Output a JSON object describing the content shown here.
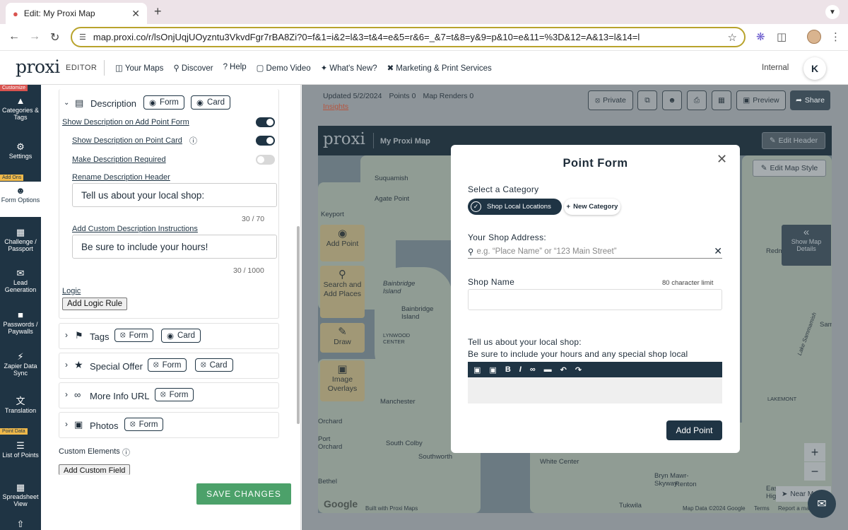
{
  "browser": {
    "tab_title": "Edit: My Proxi Map",
    "url": "map.proxi.co/r/lsOnjUqjUOyzntu3VkvdFgr7rBA8Zi?0=f&1=i&2=l&3=t&4=e&5=r&6=_&7=t&8=y&9=p&10=e&11=%3D&12=A&13=l&14=l"
  },
  "header": {
    "logo": "proxi",
    "editor_label": "EDITOR",
    "nav": [
      {
        "icon": "map-icon",
        "label": "Your Maps"
      },
      {
        "icon": "search-icon",
        "label": "Discover"
      },
      {
        "icon": "help-icon",
        "label": "Help"
      },
      {
        "icon": "video-icon",
        "label": "Demo Video"
      },
      {
        "icon": "sparkle-icon",
        "label": "What's New?"
      },
      {
        "icon": "tools-icon",
        "label": "Marketing & Print Services"
      }
    ],
    "internal_label": "Internal",
    "avatar_initial": "K"
  },
  "rail": {
    "tags": [
      "Customize",
      "Add Ons",
      "Point Data"
    ],
    "items": [
      {
        "label": "Categories & Tags"
      },
      {
        "label": "Settings"
      },
      {
        "label": "Form Options"
      },
      {
        "label": "Challenge / Passport"
      },
      {
        "label": "Lead Generation"
      },
      {
        "label": "Passwords / Paywalls"
      },
      {
        "label": "Zapier Data Sync"
      },
      {
        "label": "Translation"
      },
      {
        "label": "List of Points"
      },
      {
        "label": "Spreadsheet View"
      }
    ]
  },
  "panel": {
    "description": {
      "title": "Description",
      "form_label": "Form",
      "card_label": "Card",
      "show_on_form": "Show Description on Add Point Form",
      "show_on_card": "Show Description on Point Card",
      "make_required": "Make Description Required",
      "rename_header": "Rename Description Header",
      "header_value": "Tell us about your local shop:",
      "header_count": "30 / 70",
      "custom_instructions": "Add Custom Description Instructions",
      "instructions_value": "Be sure to include your hours!",
      "instructions_count": "30 / 1000",
      "logic_label": "Logic",
      "add_logic_rule": "Add Logic Rule"
    },
    "sections": [
      {
        "title": "Tags",
        "pills": [
          "Form",
          "Card"
        ]
      },
      {
        "title": "Special Offer",
        "pills": [
          "Form",
          "Card"
        ]
      },
      {
        "title": "More Info URL",
        "pills": [
          "Form"
        ]
      },
      {
        "title": "Photos",
        "pills": [
          "Form"
        ]
      }
    ],
    "custom_elements": "Custom Elements",
    "add_custom_field": "Add Custom Field",
    "save": "SAVE CHANGES"
  },
  "map": {
    "updated": "Updated 5/2/2024",
    "points": "Points 0",
    "renders": "Map Renders 0",
    "insights": "Insights",
    "toolbar": {
      "private": "Private",
      "preview": "Preview",
      "share": "Share"
    },
    "logo": "proxi",
    "map_name": "My Proxi Map",
    "edit_header": "Edit Header",
    "edit_style": "Edit Map Style",
    "tools": [
      "Add Point",
      "Search and Add Places",
      "Draw",
      "Image Overlays"
    ],
    "show_details": "Show Map Details",
    "near_me": "Near M",
    "labels": [
      "Suquamish",
      "Agate Point",
      "Keyport",
      "Bainbridge Island",
      "Bainbridge Island",
      "LYNWOOD CENTER",
      "Manchester",
      "Orchard",
      "Port Orchard",
      "South Colby",
      "Southworth",
      "White Center",
      "Bryn Mawr-Skyway",
      "Renton",
      "Tukwila",
      "East Highlan",
      "Redmond",
      "Sam",
      "LAKEMONT",
      "Lake Sammamish",
      "Bethel"
    ],
    "footer_built": "Built with Proxi Maps",
    "footer_data": "Map Data ©2024 Google",
    "footer_terms": "Terms",
    "footer_report": "Report a map",
    "google": "Google"
  },
  "modal": {
    "title": "Point Form",
    "select_category": "Select a Category",
    "selected_category": "Shop Local Locations",
    "new_category": "New Category",
    "address_label": "Your Shop Address:",
    "address_placeholder": "e.g. “Place Name” or “123 Main Street”",
    "name_label": "Shop Name",
    "char_limit": "80 character limit",
    "desc_label": "Tell us about your local shop:",
    "desc_help": "Be sure to include your hours and any special shop local discounts.",
    "toolbar_b": "B",
    "toolbar_i": "I",
    "add_point": "Add Point"
  }
}
